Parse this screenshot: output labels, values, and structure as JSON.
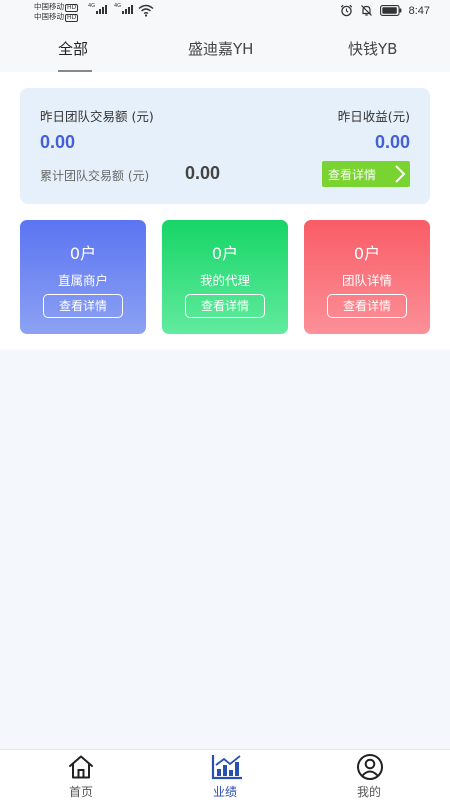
{
  "status_bar": {
    "carrier1": "中国移动",
    "carrier2": "中国移动",
    "hd": "HD",
    "network": "4G",
    "time": "8:47"
  },
  "tabs": [
    {
      "label": "全部",
      "active": true
    },
    {
      "label": "盛迪嘉YH",
      "active": false
    },
    {
      "label": "快钱YB",
      "active": false
    }
  ],
  "summary": {
    "yesterday_volume_label": "昨日团队交易额 (元)",
    "yesterday_volume": "0.00",
    "yesterday_income_label": "昨日收益(元)",
    "yesterday_income": "0.00",
    "cumulative_label": "累计团队交易额 (元)",
    "cumulative_value": "0.00",
    "detail_button": "查看详情"
  },
  "cards": [
    {
      "count": "0户",
      "title": "直属商户",
      "button": "查看详情",
      "color": "#5b74f2"
    },
    {
      "count": "0户",
      "title": "我的代理",
      "button": "查看详情",
      "color": "#16d566"
    },
    {
      "count": "0户",
      "title": "团队详情",
      "button": "查看详情",
      "color": "#f95c66"
    }
  ],
  "bottom_nav": [
    {
      "label": "首页",
      "icon": "home-icon",
      "active": false
    },
    {
      "label": "业绩",
      "icon": "chart-icon",
      "active": true
    },
    {
      "label": "我的",
      "icon": "user-icon",
      "active": false
    }
  ],
  "colors": {
    "accent_blue": "#4460d8",
    "detail_green": "#79d331",
    "nav_active": "#2a4fb3"
  }
}
